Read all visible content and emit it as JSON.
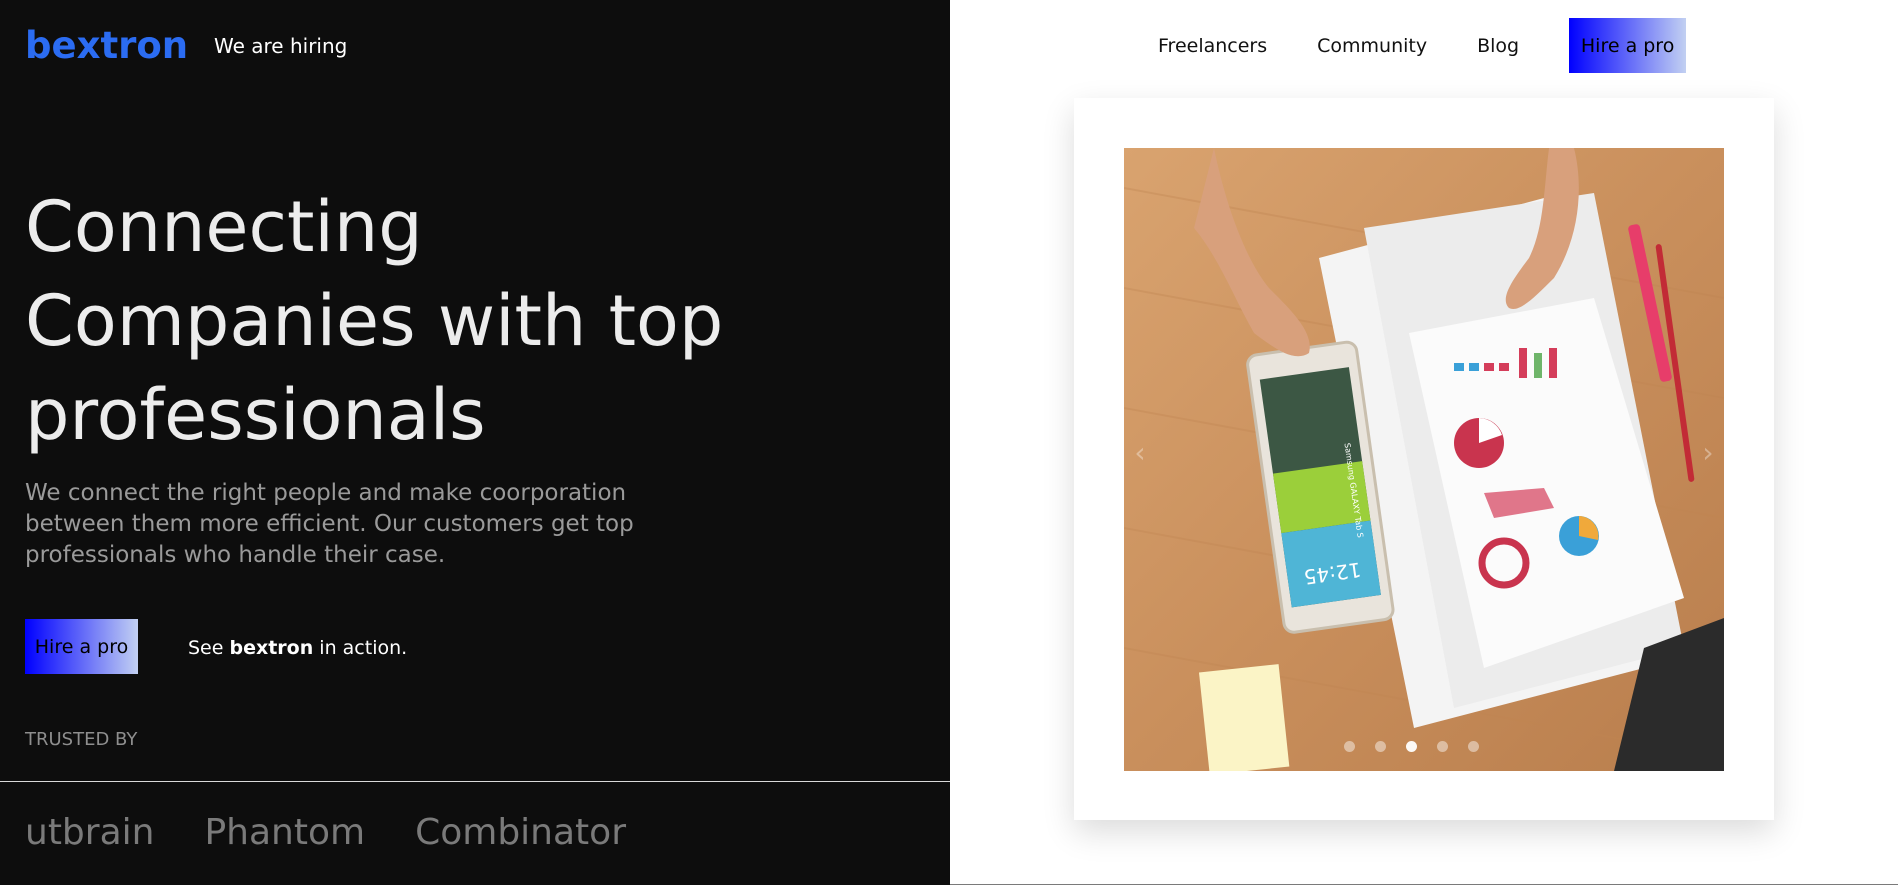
{
  "header": {
    "brand": "bextron",
    "hiring_link": "We are hiring",
    "nav": [
      "Freelancers",
      "Community",
      "Blog"
    ],
    "hire_button": "Hire a pro"
  },
  "hero": {
    "headline": "Connecting Companies with top professionals",
    "subtext": "We connect the right people and make coorporation between them more efficient. Our customers get top professionals who handle their case.",
    "cta_button": "Hire a pro",
    "see_prefix": "See ",
    "see_brand": "bextron",
    "see_suffix": " in action."
  },
  "trusted": {
    "label": "TRUSTED BY",
    "logos": [
      "utbrain",
      "Phantom",
      "Combinator"
    ]
  },
  "carousel": {
    "prev_icon": "chevron-left-icon",
    "next_icon": "chevron-right-icon",
    "active_slide": 3,
    "slide_count": 5,
    "phone_time": "12:45",
    "phone_brand": "Samsung GALAXY Tab S",
    "chart_percent": "66%"
  },
  "colors": {
    "left_bg": "#0d0d0d",
    "brand_blue": "#2b6cf2",
    "button_gradient_start": "#0000ff",
    "button_gradient_end": "#c2d0f2"
  }
}
